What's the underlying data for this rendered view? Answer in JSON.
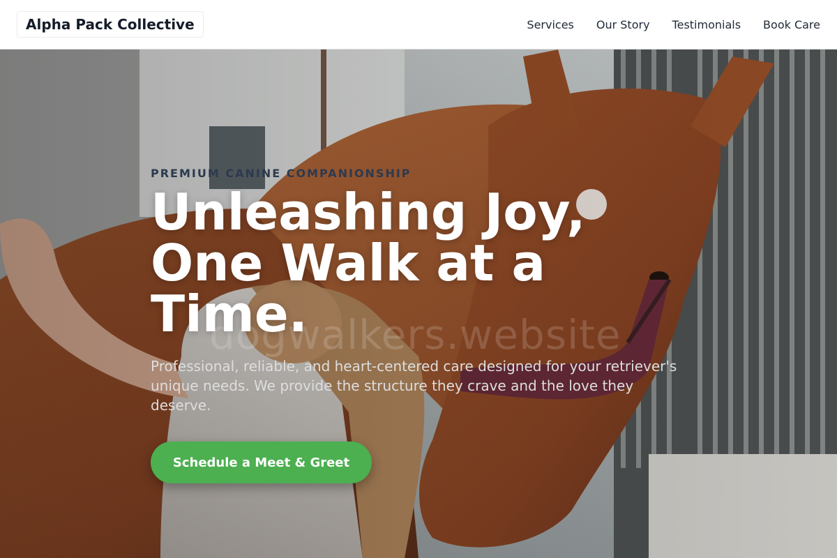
{
  "header": {
    "logo": "Alpha Pack Collective",
    "nav": [
      {
        "label": "Services"
      },
      {
        "label": "Our Story"
      },
      {
        "label": "Testimonials"
      },
      {
        "label": "Book Care"
      }
    ]
  },
  "hero": {
    "eyebrow": "PREMIUM CANINE COMPANIONSHIP",
    "headline": "Unleashing Joy, One Walk at a Time.",
    "subtext": "Professional, reliable, and heart-centered care designed for your retriever's unique needs. We provide the structure they crave and the love they deserve.",
    "cta_label": "Schedule a Meet & Greet",
    "watermark": "dogwalkers.website"
  },
  "colors": {
    "cta": "#4caf50",
    "eyebrow": "#2c3a4f",
    "logo_text": "#141c28"
  }
}
